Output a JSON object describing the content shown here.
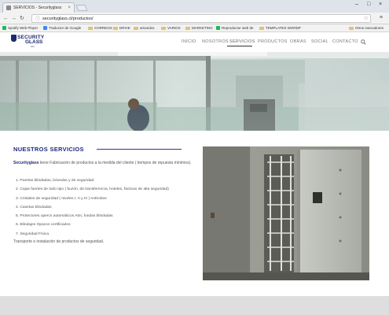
{
  "browser": {
    "tab_title": "SERVICIOS - Securityglass",
    "tab_close": "×",
    "url": "securityglass.cl/productos/",
    "window_controls": [
      "–",
      "□",
      "×"
    ],
    "bookmarks": [
      {
        "label": "Spotify Web Player",
        "icon": "spotify-icon",
        "color": "#1db954"
      },
      {
        "label": "Traductor de Google",
        "icon": "google-translate-icon",
        "color": "#4285f4"
      },
      {
        "label": "CORREOS",
        "icon": "folder-icon"
      },
      {
        "label": "DRIVE",
        "icon": "folder-icon"
      },
      {
        "label": "amandos",
        "icon": "folder-icon"
      },
      {
        "label": "VARIOS",
        "icon": "folder-icon"
      },
      {
        "label": "MARKETING",
        "icon": "folder-icon"
      },
      {
        "label": "Reproductor web de",
        "icon": "spotify-icon",
        "color": "#1db954"
      },
      {
        "label": "TEMPLATES WORDP",
        "icon": "folder-icon"
      },
      {
        "label": "Otros marcadores",
        "icon": "folder-icon"
      }
    ]
  },
  "site": {
    "logo": {
      "word1": "SECURITY",
      "word2": "GLASS",
      "sub": "ltda"
    },
    "nav": [
      {
        "label": "INICIO"
      },
      {
        "label": "NOSOTROS"
      },
      {
        "label": "SERVICIOS",
        "active": true
      },
      {
        "label": "PRODUCTOS"
      },
      {
        "label": "OBRAS"
      },
      {
        "label": "SOCIAL"
      },
      {
        "label": "CONTACTO"
      }
    ],
    "colors": {
      "brand": "#1f2b7a",
      "nav_text": "#777777"
    }
  },
  "main": {
    "title": "NUESTROS SERVICIOS",
    "intro_brand": "Securityglass",
    "intro_text": " tiene Fabricación de productos a la medida del cliente ( tiempos de repuesta mínimos).",
    "services": [
      {
        "num": "1.",
        "text": "Puertas blindadas, bóvedas y de seguridad"
      },
      {
        "num": "2.",
        "text": "Cajas fuertes de todo tipo ( buzón, de transferencia, hoteles, fácticas de alta seguridad)"
      },
      {
        "num": "3.",
        "text": "Cristales de seguridad ( niveles I, II y III ) Antirobos"
      },
      {
        "num": "4.",
        "text": "Casetas blindadas"
      },
      {
        "num": "5.",
        "text": "Protectores opercs automáticos Atm, fundas blindadas"
      },
      {
        "num": "6.",
        "text": "Blindajes Opacos certificados"
      },
      {
        "num": "7.",
        "text": "Seguridad Física"
      }
    ],
    "outro": "Transporte e instalación de productos de seguridad."
  }
}
